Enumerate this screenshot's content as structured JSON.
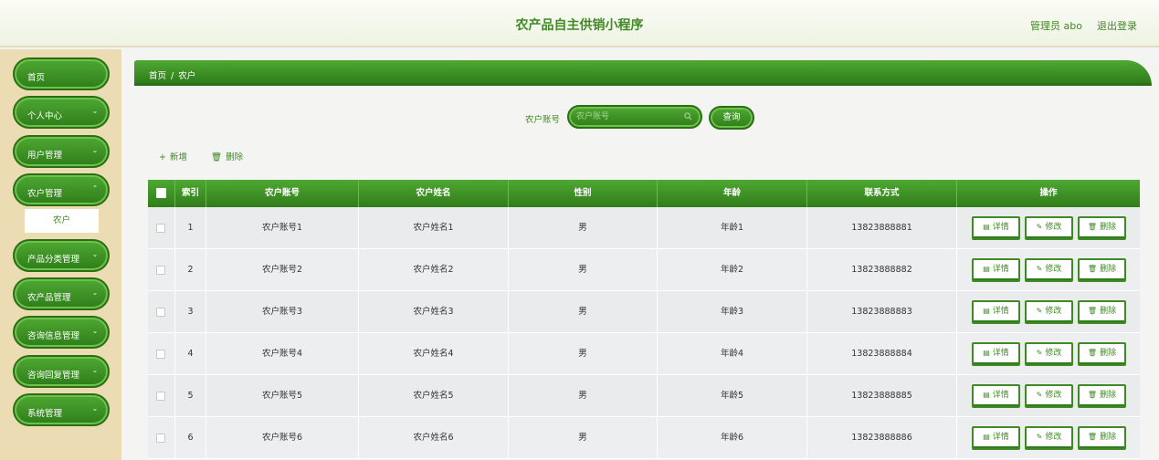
{
  "header": {
    "title": "农产品自主供销小程序",
    "user": "管理员 abo",
    "logout": "退出登录"
  },
  "sidebar": {
    "items": [
      {
        "label": "首页",
        "expandable": false
      },
      {
        "label": "个人中心",
        "expandable": true
      },
      {
        "label": "用户管理",
        "expandable": true
      },
      {
        "label": "农户管理",
        "expandable": true
      },
      {
        "label": "产品分类管理",
        "expandable": true
      },
      {
        "label": "农产品管理",
        "expandable": true
      },
      {
        "label": "咨询信息管理",
        "expandable": true
      },
      {
        "label": "咨询回复管理",
        "expandable": true
      },
      {
        "label": "系统管理",
        "expandable": true
      }
    ],
    "sub_item": "农户"
  },
  "breadcrumb": {
    "home": "首页",
    "separator": "/",
    "current": "农户"
  },
  "search": {
    "label": "农户账号",
    "placeholder": "农户账号",
    "value": "",
    "button": "查询"
  },
  "toolbar": {
    "add": "新增",
    "delete": "删除"
  },
  "table": {
    "headers": [
      "索引",
      "农户账号",
      "农户姓名",
      "性别",
      "年龄",
      "联系方式",
      "操作"
    ],
    "rows": [
      {
        "index": "1",
        "account": "农户账号1",
        "name": "农户姓名1",
        "gender": "男",
        "age": "年龄1",
        "phone": "13823888881"
      },
      {
        "index": "2",
        "account": "农户账号2",
        "name": "农户姓名2",
        "gender": "男",
        "age": "年龄2",
        "phone": "13823888882"
      },
      {
        "index": "3",
        "account": "农户账号3",
        "name": "农户姓名3",
        "gender": "男",
        "age": "年龄3",
        "phone": "13823888883"
      },
      {
        "index": "4",
        "account": "农户账号4",
        "name": "农户姓名4",
        "gender": "男",
        "age": "年龄4",
        "phone": "13823888884"
      },
      {
        "index": "5",
        "account": "农户账号5",
        "name": "农户姓名5",
        "gender": "男",
        "age": "年龄5",
        "phone": "13823888885"
      },
      {
        "index": "6",
        "account": "农户账号6",
        "name": "农户姓名6",
        "gender": "男",
        "age": "年龄6",
        "phone": "13823888886"
      }
    ],
    "actions": {
      "detail": "详情",
      "edit": "修改",
      "delete": "删除"
    }
  },
  "colors": {
    "primary": "#3f8a24",
    "sidebar_bg": "#ecdcb4"
  }
}
